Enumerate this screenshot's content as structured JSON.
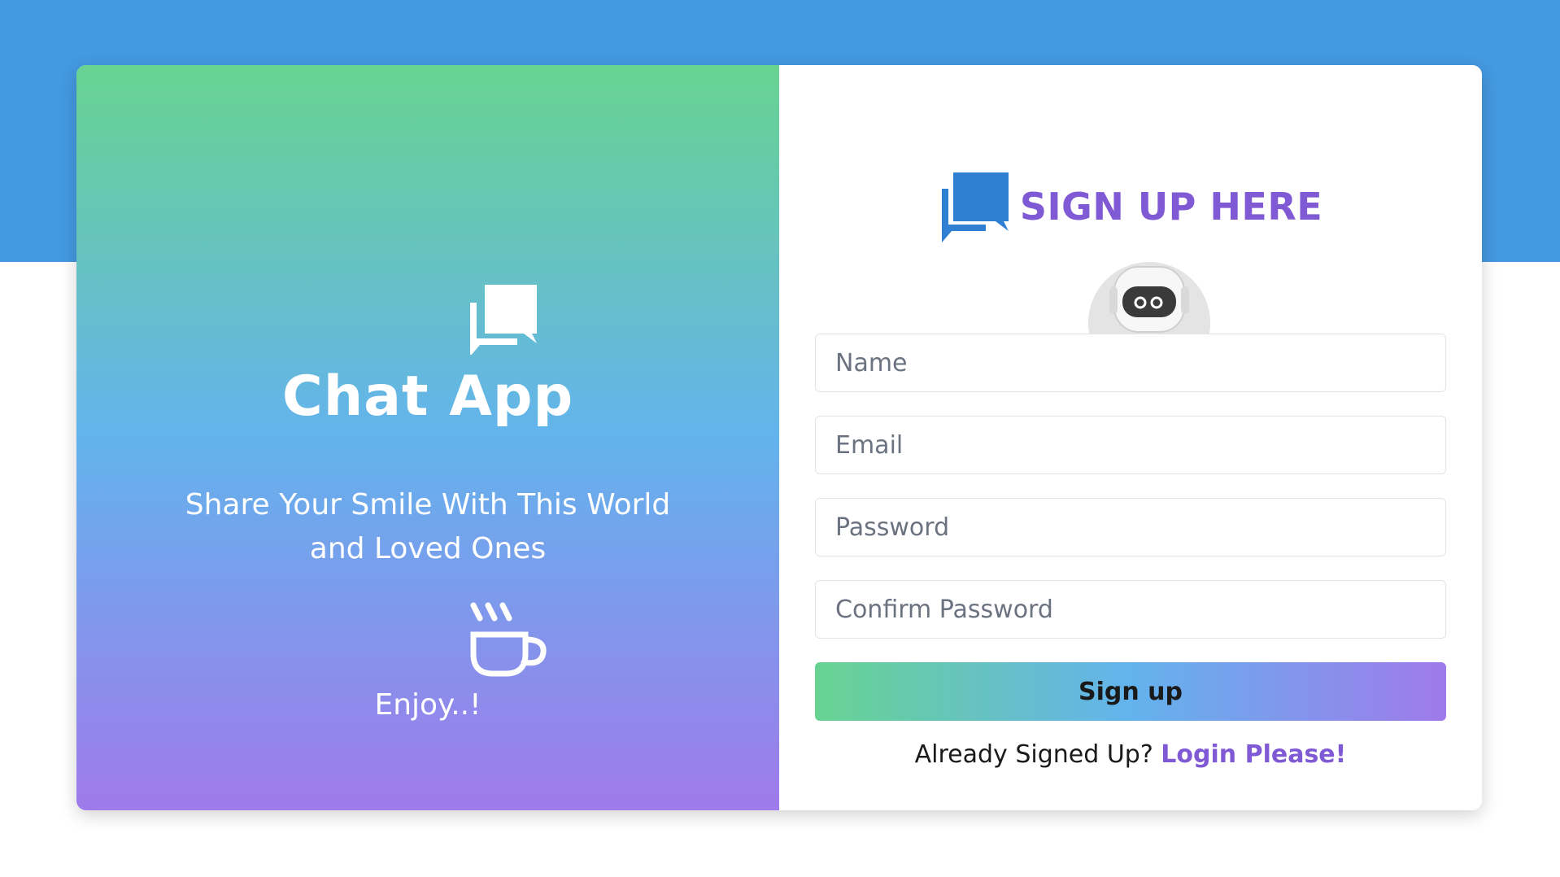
{
  "brand": {
    "title": "Chat App",
    "tagline": "Share Your Smile With This World and Loved Ones",
    "enjoy": "Enjoy..!",
    "chat_icon": "chat-bubbles-icon",
    "coffee_icon": "coffee-cup-icon"
  },
  "form": {
    "heading": "SIGN UP HERE",
    "heading_icon": "chat-bubbles-icon",
    "avatar_add_label": "+",
    "name_placeholder": "Name",
    "email_placeholder": "Email",
    "password_placeholder": "Password",
    "confirm_password_placeholder": "Confirm Password",
    "submit_label": "Sign up",
    "already_text": "Already Signed Up?",
    "login_link": "Login Please!"
  },
  "colors": {
    "top_band": "#4499e0",
    "gradient_green": "#68d391",
    "gradient_blue": "#63b3ed",
    "gradient_purple": "#9f7aea",
    "accent_purple": "#805ad5",
    "icon_blue": "#2f86d6"
  }
}
